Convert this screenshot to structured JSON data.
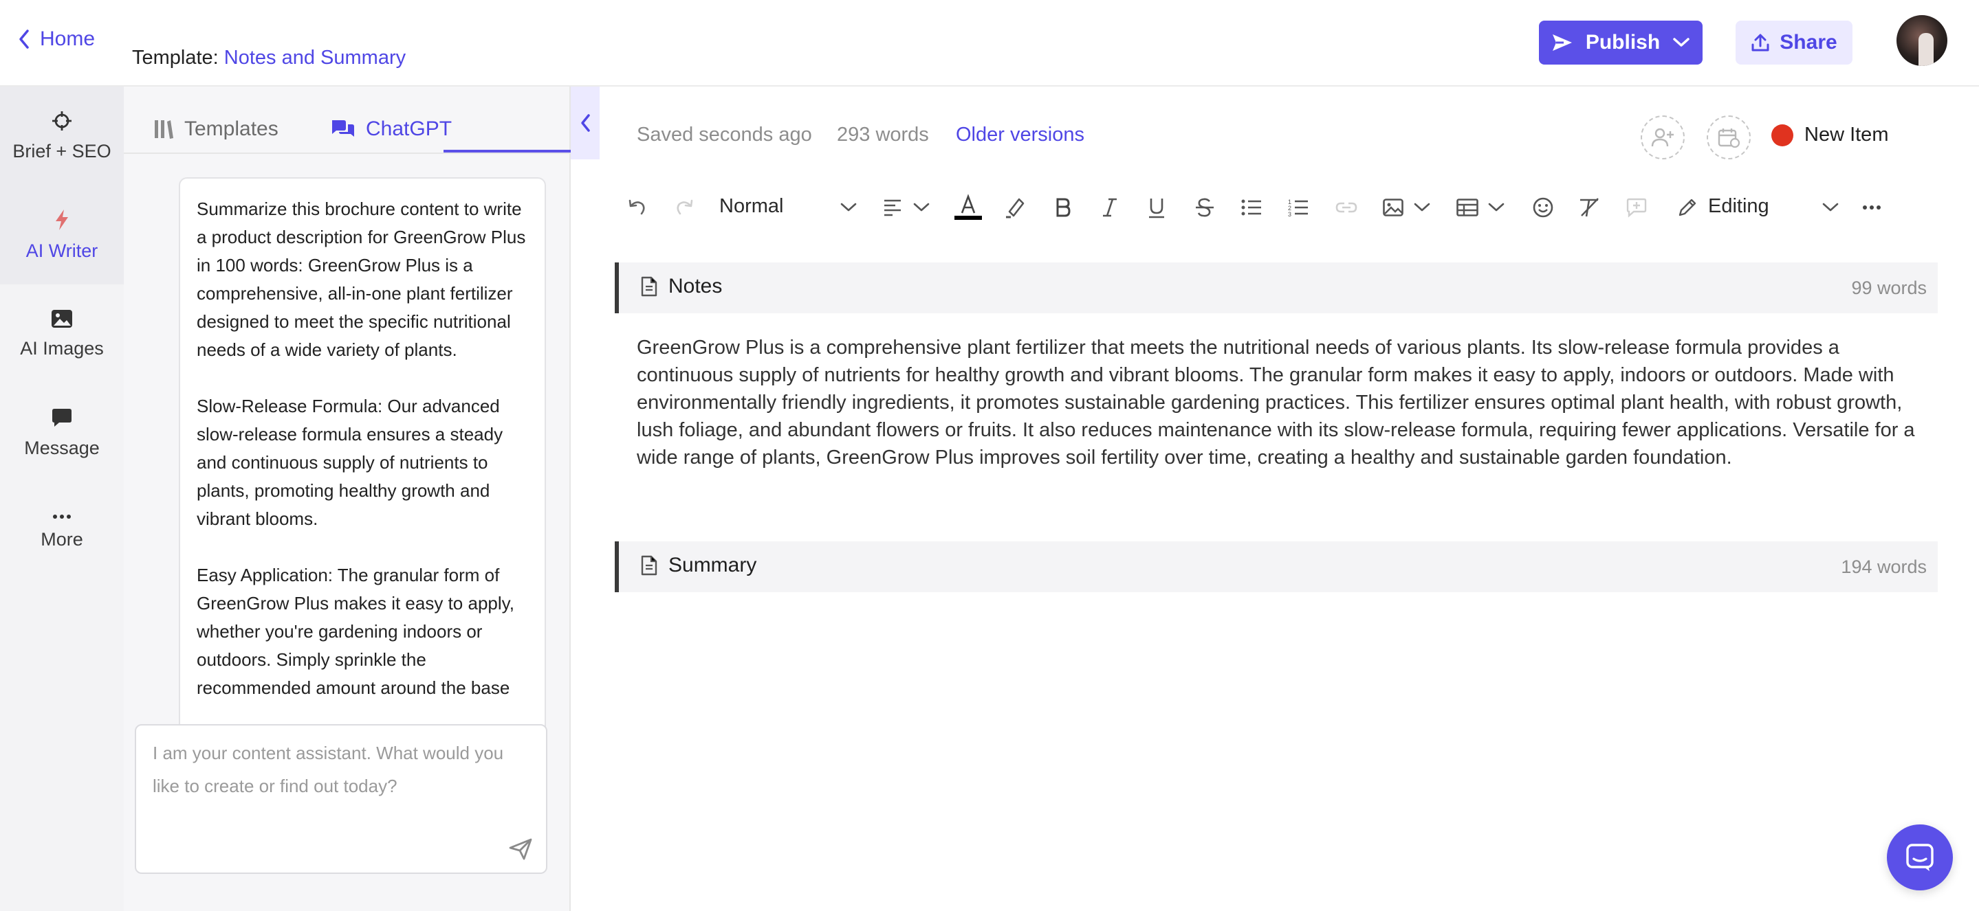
{
  "header": {
    "home_label": "Home",
    "template_prefix": "Template:",
    "template_name": "Notes and Summary",
    "publish_label": "Publish",
    "share_label": "Share"
  },
  "sidebar": {
    "items": [
      {
        "label": "Brief + SEO",
        "icon": "crosshair-icon"
      },
      {
        "label": "AI Writer",
        "icon": "lightning-icon"
      },
      {
        "label": "AI Images",
        "icon": "image-icon"
      },
      {
        "label": "Message",
        "icon": "message-icon"
      },
      {
        "label": "More",
        "icon": "ellipsis-icon"
      }
    ],
    "active_index": 1
  },
  "chat": {
    "tabs": [
      {
        "label": "Templates",
        "icon": "templates-icon"
      },
      {
        "label": "ChatGPT",
        "icon": "chat-icon"
      }
    ],
    "active_tab": 1,
    "prompt_paragraphs": [
      "Summarize this brochure content to write a product description for GreenGrow Plus in 100 words: GreenGrow Plus is a comprehensive, all-in-one plant fertilizer designed to meet the specific nutritional needs of a wide variety of plants.",
      "Slow-Release Formula: Our advanced slow-release formula ensures a steady and continuous supply of nutrients to plants, promoting healthy growth and vibrant blooms.",
      "Easy Application: The granular form of GreenGrow Plus makes it easy to apply, whether you're gardening indoors or outdoors. Simply sprinkle the recommended amount around the base"
    ],
    "input_placeholder": "I am your content assistant. What would you like to create or find out today?",
    "input_value": ""
  },
  "editor": {
    "saved_status": "Saved seconds ago",
    "word_count": "293 words",
    "older_versions": "Older versions",
    "item_status": "New Item",
    "status_color": "#e0331f",
    "toolbar": {
      "style_value": "Normal",
      "mode_label": "Editing"
    },
    "sections": [
      {
        "title": "Notes",
        "count": "99 words",
        "body": "GreenGrow Plus is a comprehensive plant fertilizer that meets the nutritional needs of various plants. Its slow-release formula provides a continuous supply of nutrients for healthy growth and vibrant blooms. The granular form makes it easy to apply, indoors or outdoors. Made with environmentally friendly ingredients, it promotes sustainable gardening practices. This fertilizer ensures optimal plant health, with robust growth, lush foliage, and abundant flowers or fruits. It also reduces maintenance with its slow-release formula, requiring fewer applications. Versatile for a wide range of plants, GreenGrow Plus improves soil fertility over time, creating a healthy and sustainable garden foundation."
      },
      {
        "title": "Summary",
        "count": "194 words",
        "body": ""
      }
    ]
  },
  "colors": {
    "accent": "#5b50e8",
    "accent_text": "#4f46e5",
    "accent_light": "#eceaff"
  }
}
